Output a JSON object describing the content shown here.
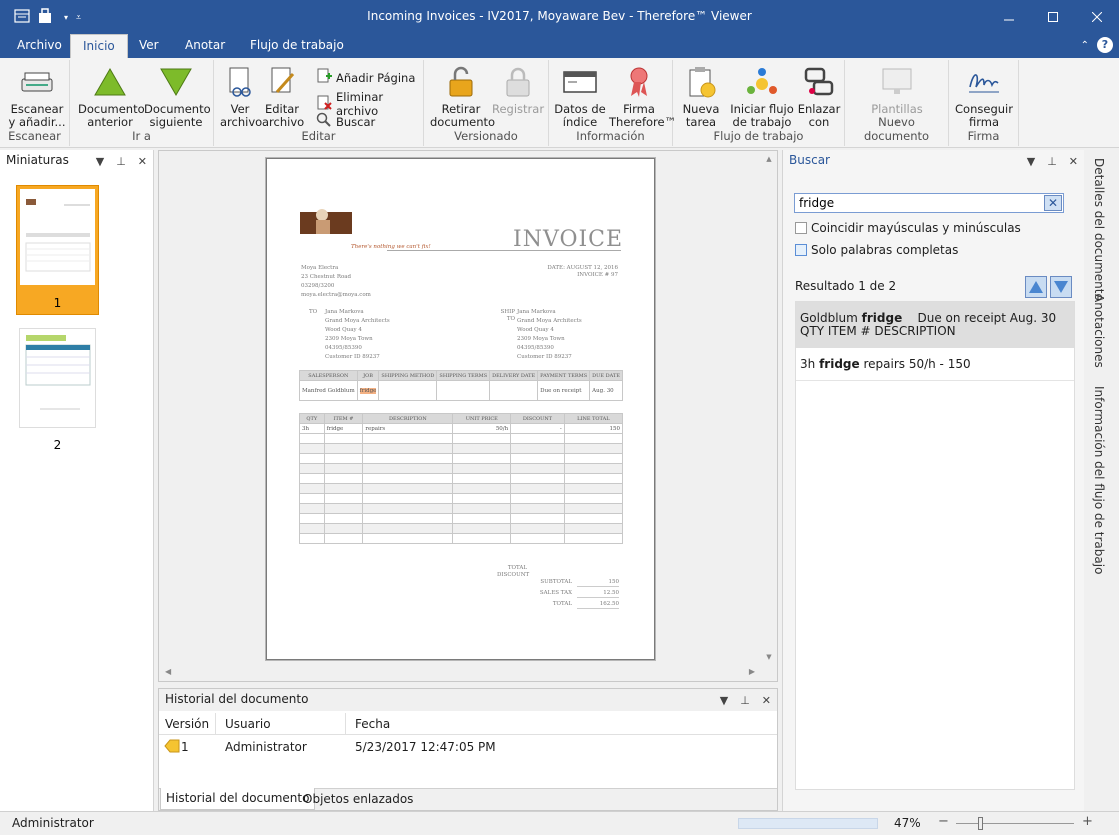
{
  "window": {
    "title": "Incoming Invoices - IV2017, Moyaware Bev - Therefore™ Viewer"
  },
  "menu": {
    "tabs": [
      "Archivo",
      "Inicio",
      "Ver",
      "Anotar",
      "Flujo de trabajo"
    ],
    "active": "Inicio"
  },
  "ribbon": {
    "groups": {
      "escanear": "Escanear",
      "ira": "Ir a",
      "editar": "Editar",
      "versionado": "Versionado",
      "informacion": "Información",
      "flujo": "Flujo de trabajo",
      "nuevo": "Nuevo documento",
      "firma": "Firma"
    },
    "buttons": {
      "escanear": "Escanear y añadir...",
      "doc_anterior": "Documento anterior",
      "doc_siguiente": "Documento siguiente",
      "ver_archivo": "Ver archivo",
      "editar_archivo": "Editar archivo",
      "anadir_pagina": "Añadir Página",
      "eliminar_archivo": "Eliminar archivo",
      "buscar": "Buscar",
      "retirar": "Retirar documento",
      "registrar": "Registrar",
      "datos_indice": "Datos de índice",
      "firma_therefore": "Firma Therefore™",
      "nueva_tarea": "Nueva tarea",
      "iniciar_flujo": "Iniciar flujo de trabajo",
      "enlazar": "Enlazar con",
      "plantillas": "Plantillas",
      "conseguir_firma": "Conseguir firma"
    }
  },
  "thumbnails": {
    "title": "Miniaturas",
    "pages": [
      "1",
      "2"
    ]
  },
  "invoice": {
    "heading": "INVOICE",
    "tagline": "There's nothing we can't fix!",
    "from": [
      "Moya Electra",
      "23 Chestnut Road",
      "03298/3200",
      "moya.electra@moya.com"
    ],
    "date_line": "DATE: AUGUST 12, 2016",
    "invoice_line": "INVOICE # 97",
    "to_label": "TO",
    "ship_label": "SHIP TO",
    "to": [
      "Jana Markova",
      "Grand Moya Architects",
      "Wood Quay 4",
      "2309 Moya Town",
      "04395/85390",
      "Customer ID 89237"
    ],
    "ship": [
      "Jana Markova",
      "Grand Moya Architects",
      "Wood Quay 4",
      "2309 Moya Town",
      "04395/85390",
      "Customer ID 89237"
    ],
    "order_headers": [
      "SALESPERSON",
      "JOB",
      "SHIPPING METHOD",
      "SHIPPING TERMS",
      "DELIVERY DATE",
      "PAYMENT TERMS",
      "DUE DATE"
    ],
    "order_row": [
      "Manfred Goldblum",
      "fridge",
      "",
      "",
      "",
      "Due on receipt",
      "Aug. 30"
    ],
    "item_headers": [
      "QTY",
      "ITEM #",
      "DESCRIPTION",
      "UNIT PRICE",
      "DISCOUNT",
      "LINE TOTAL"
    ],
    "item_row": [
      "3h",
      "fridge",
      "repairs",
      "50/h",
      "-",
      "150"
    ],
    "total_discount": "TOTAL DISCOUNT",
    "subtotal_label": "SUBTOTAL",
    "subtotal": "150",
    "tax_label": "SALES TAX",
    "tax": "12.50",
    "total_label": "TOTAL",
    "total": "162.50"
  },
  "history": {
    "title": "Historial del documento",
    "columns": [
      "Versión",
      "Usuario",
      "Fecha"
    ],
    "rows": [
      {
        "version": "1",
        "user": "Administrator",
        "date": "5/23/2017 12:47:05 PM"
      }
    ],
    "tabs": [
      "Historial del documento",
      "Objetos enlazados"
    ]
  },
  "search": {
    "title": "Buscar",
    "query": "fridge",
    "match_case": "Coincidir mayúsculas y minúsculas",
    "whole_words": "Solo palabras completas",
    "result_count": "Resultado 1 de 2",
    "results": [
      {
        "before": "Goldblum ",
        "hit": "fridge",
        "after": "    Due on receipt Aug. 30  QTY ITEM # DESCRIPTION"
      },
      {
        "before": "3h ",
        "hit": "fridge",
        "after": " repairs 50/h - 150"
      }
    ]
  },
  "side_tabs": [
    "Detalles del documento",
    "Anotaciones",
    "Información del flujo de trabajo"
  ],
  "status": {
    "user": "Administrator",
    "zoom": "47%"
  }
}
